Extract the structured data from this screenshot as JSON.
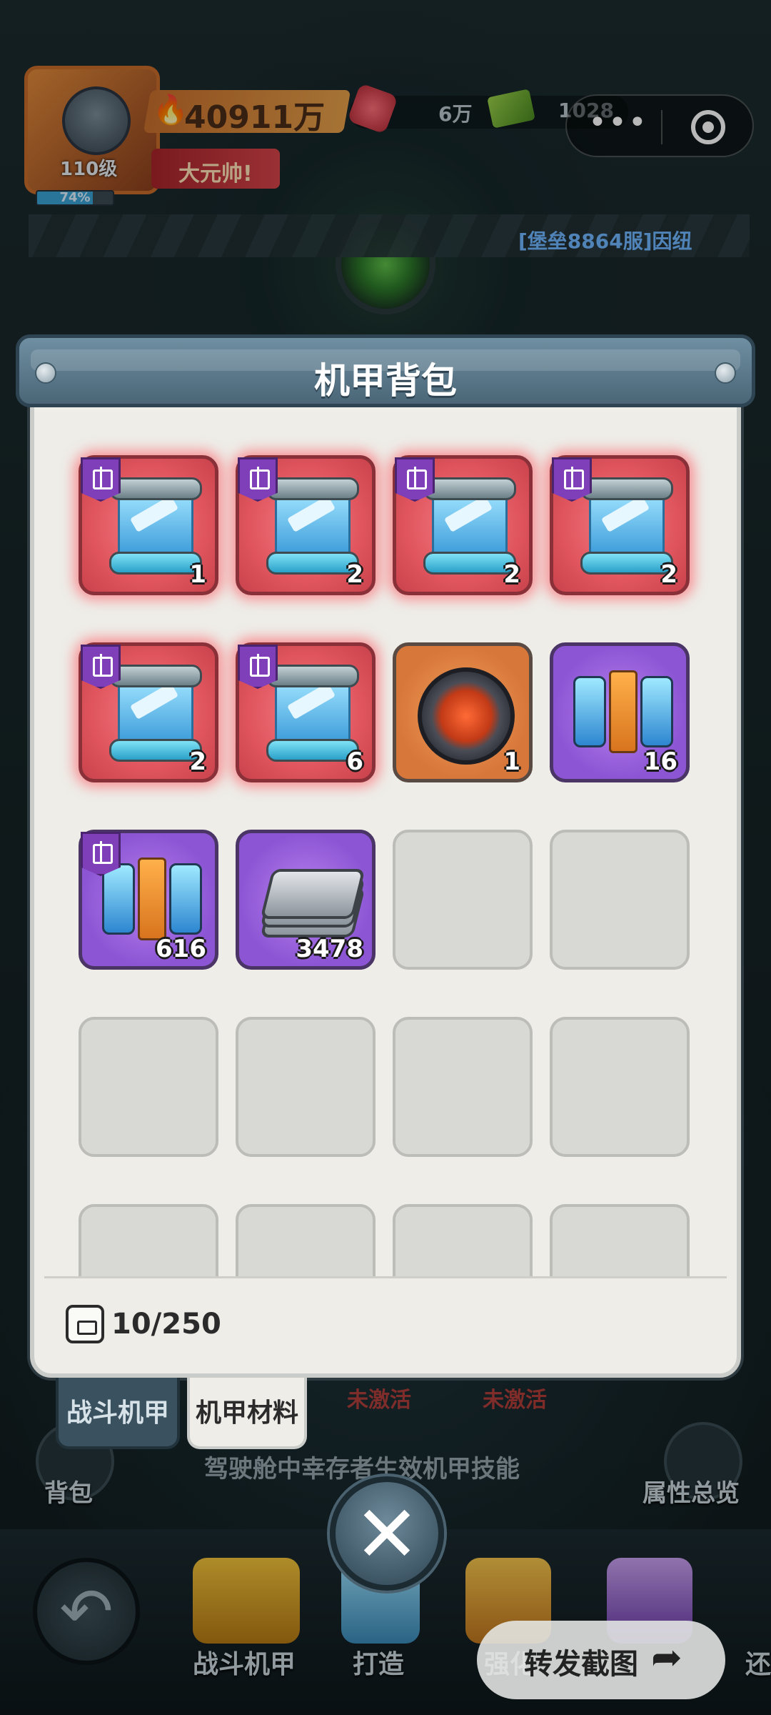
{
  "player": {
    "power": "40911万",
    "level": "110级",
    "exp_percent": "74%",
    "exp_fraction": 0.74,
    "rank_title": "大元帅!",
    "gems": "6万",
    "cash": "1028"
  },
  "marquee": "[堡垒8864服]因纽",
  "panel": {
    "title": "机甲背包",
    "capacity": "10/250",
    "items": [
      {
        "type": "scroll",
        "rarity": "red",
        "gift": true,
        "qty": "1"
      },
      {
        "type": "scroll",
        "rarity": "red",
        "gift": true,
        "qty": "2"
      },
      {
        "type": "scroll",
        "rarity": "red",
        "gift": true,
        "qty": "2"
      },
      {
        "type": "scroll",
        "rarity": "red",
        "gift": true,
        "qty": "2"
      },
      {
        "type": "scroll",
        "rarity": "red",
        "gift": true,
        "qty": "2"
      },
      {
        "type": "scroll",
        "rarity": "red",
        "gift": true,
        "qty": "6"
      },
      {
        "type": "core",
        "rarity": "orange",
        "gift": false,
        "qty": "1"
      },
      {
        "type": "battery",
        "rarity": "purple",
        "gift": false,
        "qty": "16"
      },
      {
        "type": "battery",
        "rarity": "purple",
        "gift": true,
        "qty": "616"
      },
      {
        "type": "plate",
        "rarity": "purple",
        "gift": false,
        "qty": "3478"
      }
    ],
    "empty_slots": 10
  },
  "tabs": {
    "combat": "战斗机甲",
    "materials": "机甲材料"
  },
  "background": {
    "inactive_left": "未激活",
    "inactive_right": "未激活",
    "hint": "驾驶舱中幸存者生效机甲技能",
    "bag": "背包",
    "stats": "属性总览"
  },
  "bottom_nav": {
    "combat_mech": "战斗机甲",
    "forge": "打造",
    "enhance": "强化",
    "restore": "还"
  },
  "share": {
    "label": "转发截图"
  },
  "icons": {
    "close": "close-icon",
    "share": "share-arrow-icon",
    "capacity": "backpack-icon",
    "back": "back-arrow-icon"
  },
  "colors": {
    "panel_bg": "#eeede8",
    "header_blue": "#5a7a8d",
    "rarity_red": "#e0555e",
    "rarity_purple": "#8c55d4",
    "rarity_orange": "#d8773a"
  }
}
